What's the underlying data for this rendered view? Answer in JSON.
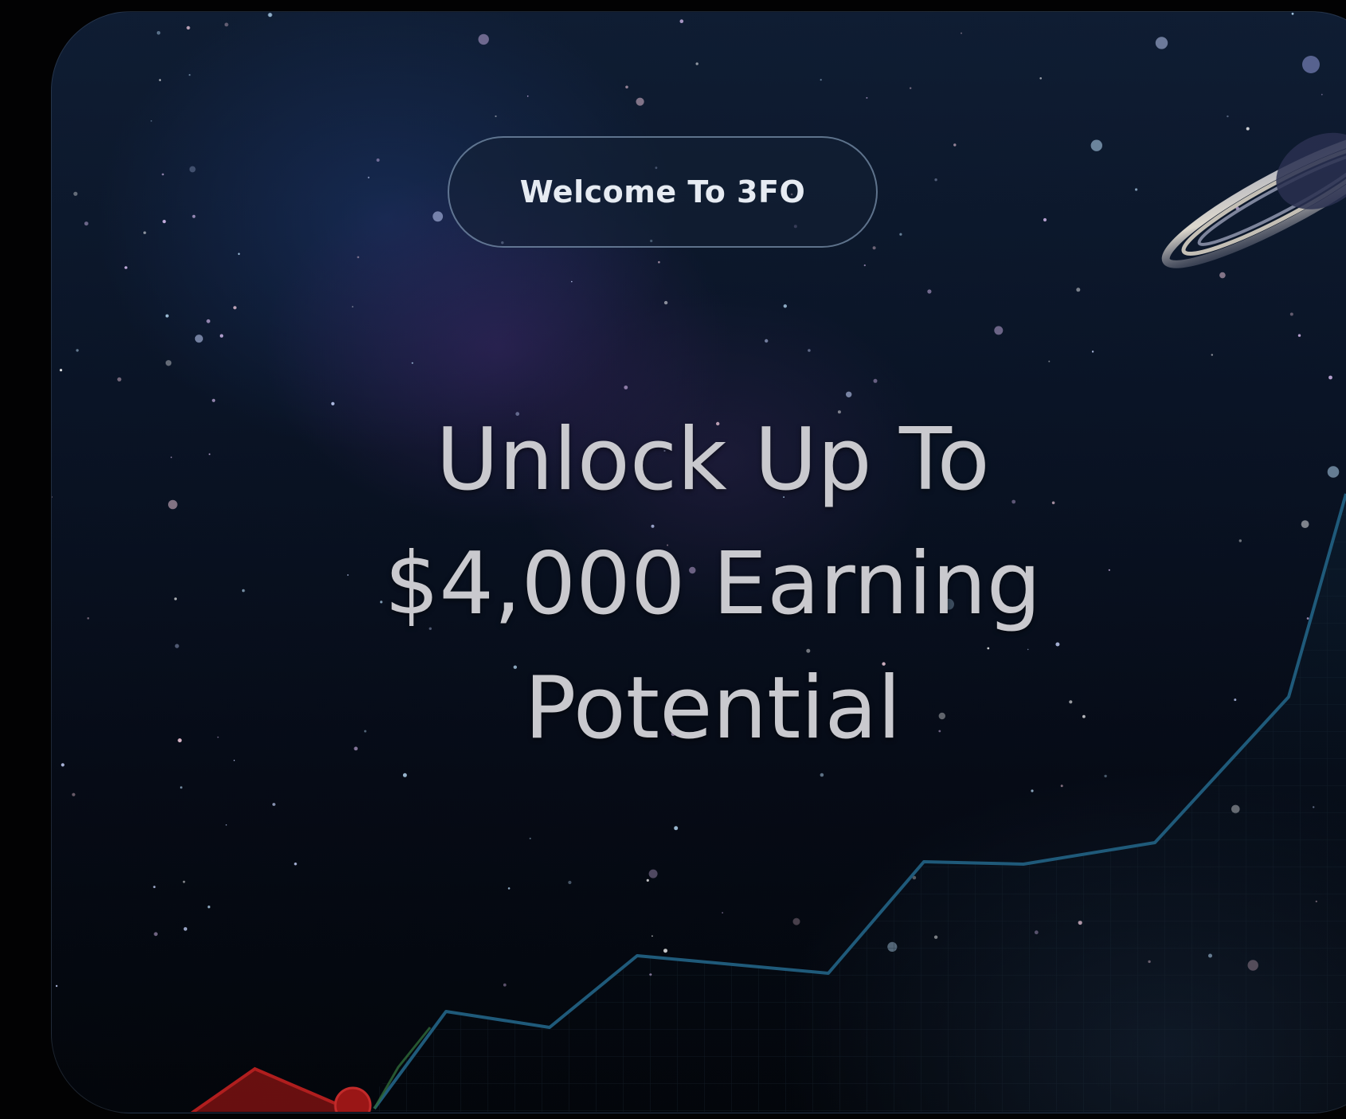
{
  "hero": {
    "welcome_label": "Welcome To 3FO",
    "headline_lines": [
      "Unlock Up To",
      "$4,000 Earning",
      "Potential"
    ]
  },
  "colors": {
    "page_background": "#000000",
    "card_background": "#0a1426",
    "growth_line": "#1f5a7a",
    "red_line": "#b01e1e",
    "headline_text": "#c9c9ce",
    "pill_text": "#e6ebf2"
  },
  "icons": [
    "saturn-planet-icon",
    "growth-chart-graphic"
  ]
}
